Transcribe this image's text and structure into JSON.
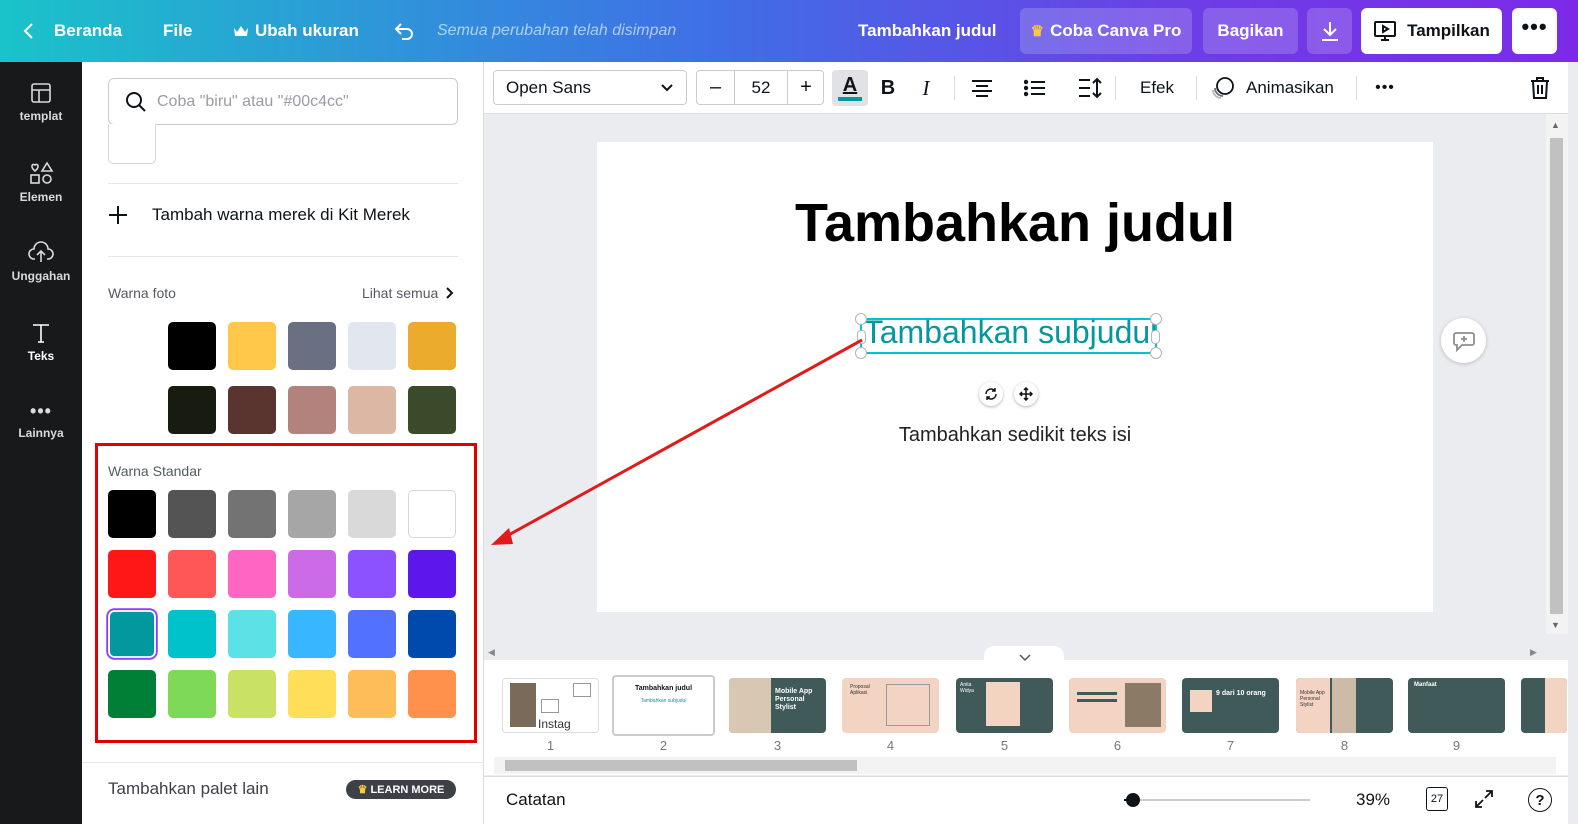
{
  "topbar": {
    "back_label": "Beranda",
    "file_label": "File",
    "resize_label": "Ubah ukuran",
    "saved_status": "Semua perubahan telah disimpan",
    "design_title": "Tambahkan judul",
    "pro_label": "Coba Canva Pro",
    "share_label": "Bagikan",
    "present_label": "Tampilkan"
  },
  "sidebar": {
    "items": [
      {
        "label": "templat",
        "icon": "template-icon"
      },
      {
        "label": "Elemen",
        "icon": "elements-icon"
      },
      {
        "label": "Unggahan",
        "icon": "upload-cloud-icon"
      },
      {
        "label": "Teks",
        "icon": "text-icon"
      },
      {
        "label": "Lainnya",
        "icon": "more-dots-icon"
      }
    ]
  },
  "panel": {
    "search_placeholder": "Coba \"biru\" atau \"#00c4cc\"",
    "add_brand_label": "Tambah warna merek di Kit Merek",
    "photo_colors_label": "Warna foto",
    "see_all_label": "Lihat semua",
    "photo_colors": [
      "#000000",
      "#ffc84a",
      "#6b6f82",
      "#e2e6ee",
      "#ebab2c",
      "#181b10",
      "#5a3530",
      "#b2837c",
      "#dbb7a4",
      "#3b4a2a"
    ],
    "standard_label": "Warna Standar",
    "standard_colors": [
      "#000000",
      "#545454",
      "#737373",
      "#a6a6a6",
      "#d9d9d9",
      "#ffffff",
      "#ff1616",
      "#ff5757",
      "#ff66c4",
      "#cb6ce6",
      "#8c52ff",
      "#5e17eb",
      "#03989e",
      "#00c2cb",
      "#5ce1e6",
      "#38b6ff",
      "#5271ff",
      "#004aad",
      "#008037",
      "#7ed957",
      "#c9e265",
      "#ffde59",
      "#ffbd59",
      "#ff914d"
    ],
    "add_palette_label": "Tambahkan palet lain",
    "learn_more_label": "LEARN MORE"
  },
  "toolbar": {
    "font_name": "Open Sans",
    "font_size": "52",
    "effects_label": "Efek",
    "animate_label": "Animasikan"
  },
  "page": {
    "title": "Tambahkan judul",
    "subtitle": "Tambahkan subjudul",
    "body": "Tambahkan sedikit teks isi"
  },
  "thumbnails": {
    "numbers": [
      "1",
      "2",
      "3",
      "4",
      "5",
      "6",
      "7",
      "8",
      "9"
    ],
    "t1_text": "Instag",
    "t2_title": "Tambahkan judul",
    "t2_sub": "Tambahkan subjudul",
    "t3_text": "Mobile App Personal Stylist",
    "t4_text": "Proposal Aplikasi",
    "t5_text": "Anita Widya",
    "t7_text": "9 dari 10 orang",
    "t8_text": "Mobile App Personal Stylist",
    "t9_text": "Manfaat"
  },
  "bottombar": {
    "notes_label": "Catatan",
    "zoom_value": "39%",
    "page_count": "27"
  },
  "colors": {
    "accent": "#8b3dff",
    "selection": "#00c4cc",
    "highlight_box": "#e00000"
  }
}
